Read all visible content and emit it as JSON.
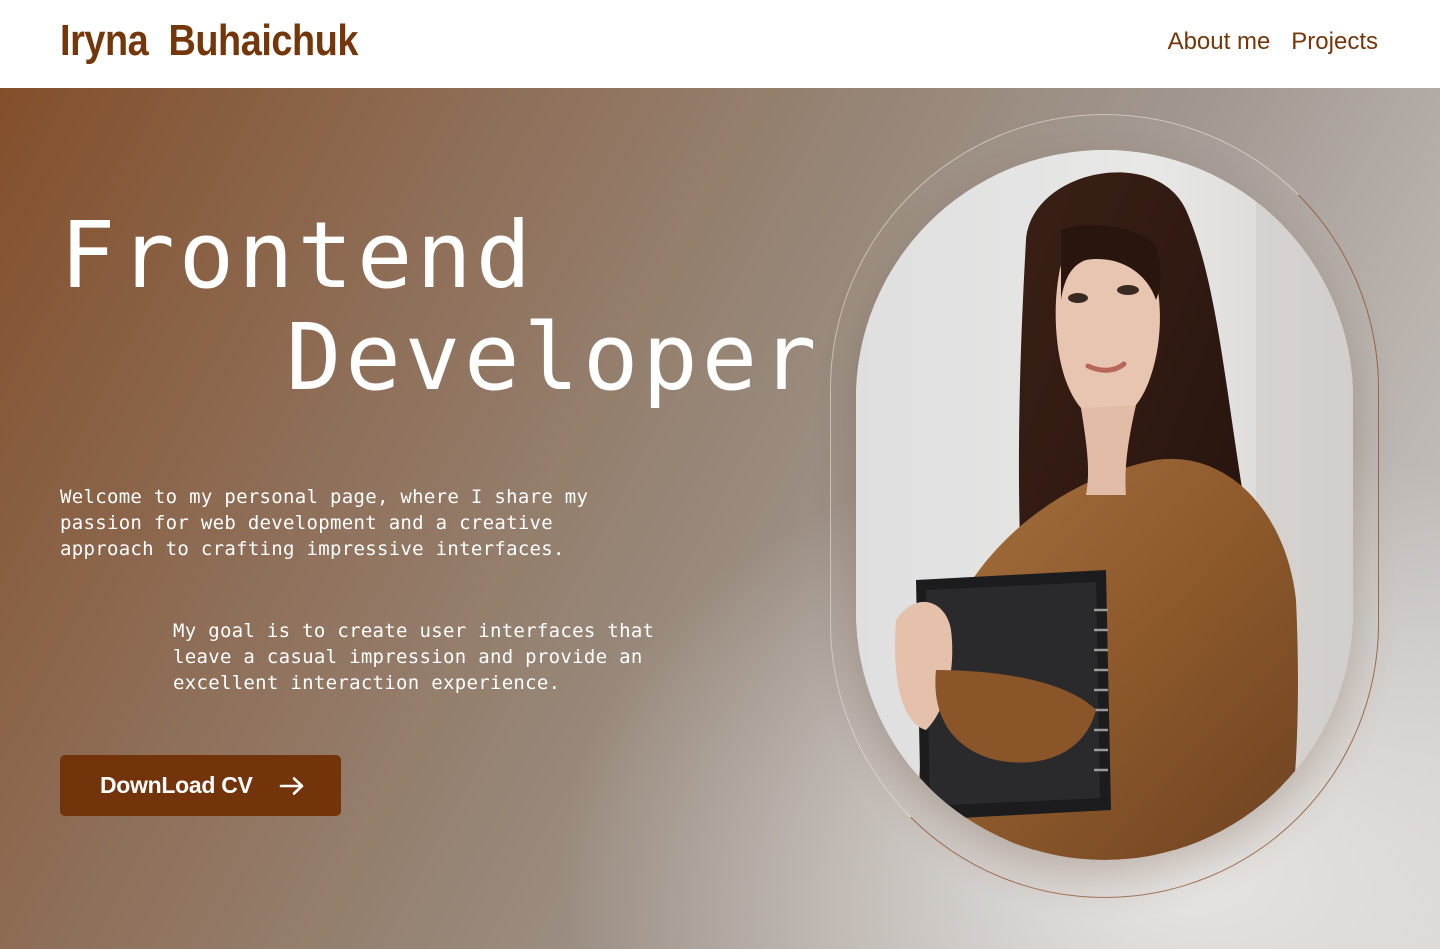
{
  "header": {
    "logo": "Iryna  Buhaichuk",
    "nav": [
      {
        "label": "About me"
      },
      {
        "label": "Projects"
      }
    ]
  },
  "hero": {
    "headline_line1": "Frontend",
    "headline_line2": "Developer",
    "paragraph1": "Welcome to my personal page, where I share my passion for web development and a creative approach to crafting impressive interfaces.",
    "paragraph2": "My goal is to create user interfaces that leave a casual impression and provide an excellent interaction experience.",
    "cta_label": "DownLoad CV",
    "cta_icon": "arrow-right-icon",
    "photo_subject": "portrait-photo"
  },
  "colors": {
    "brand": "#74360b",
    "button": "#74340b",
    "text_on_hero": "#ffffff",
    "gradient_start": "#834f2b",
    "gradient_end": "#cfcbc8"
  }
}
